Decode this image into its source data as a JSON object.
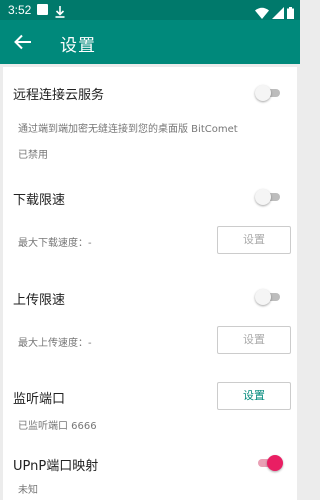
{
  "status_bar": {
    "time": "3:52"
  },
  "app_bar": {
    "title": "设置"
  },
  "remote": {
    "label": "远程连接云服务",
    "description": "通过端到端加密无缝连接到您的桌面版 BitComet",
    "status": "已禁用",
    "toggle_on": false
  },
  "download_limit": {
    "label": "下载限速",
    "toggle_on": false,
    "max_label": "最大下载速度：-",
    "button_label": "设置"
  },
  "upload_limit": {
    "label": "上传限速",
    "toggle_on": false,
    "max_label": "最大上传速度：-",
    "button_label": "设置"
  },
  "listen_port": {
    "label": "监听端口",
    "button_label": "设置",
    "status": "已监听端口 6666"
  },
  "upnp": {
    "label": "UPnP端口映射",
    "toggle_on": true,
    "status": "未知"
  },
  "colors": {
    "primary": "#00897b",
    "status_bar": "#00796b",
    "accent": "#e91e63"
  },
  "icons": [
    "image-notification-icon",
    "download-icon",
    "wifi-icon",
    "signal-icon",
    "battery-icon",
    "back-arrow-icon"
  ]
}
